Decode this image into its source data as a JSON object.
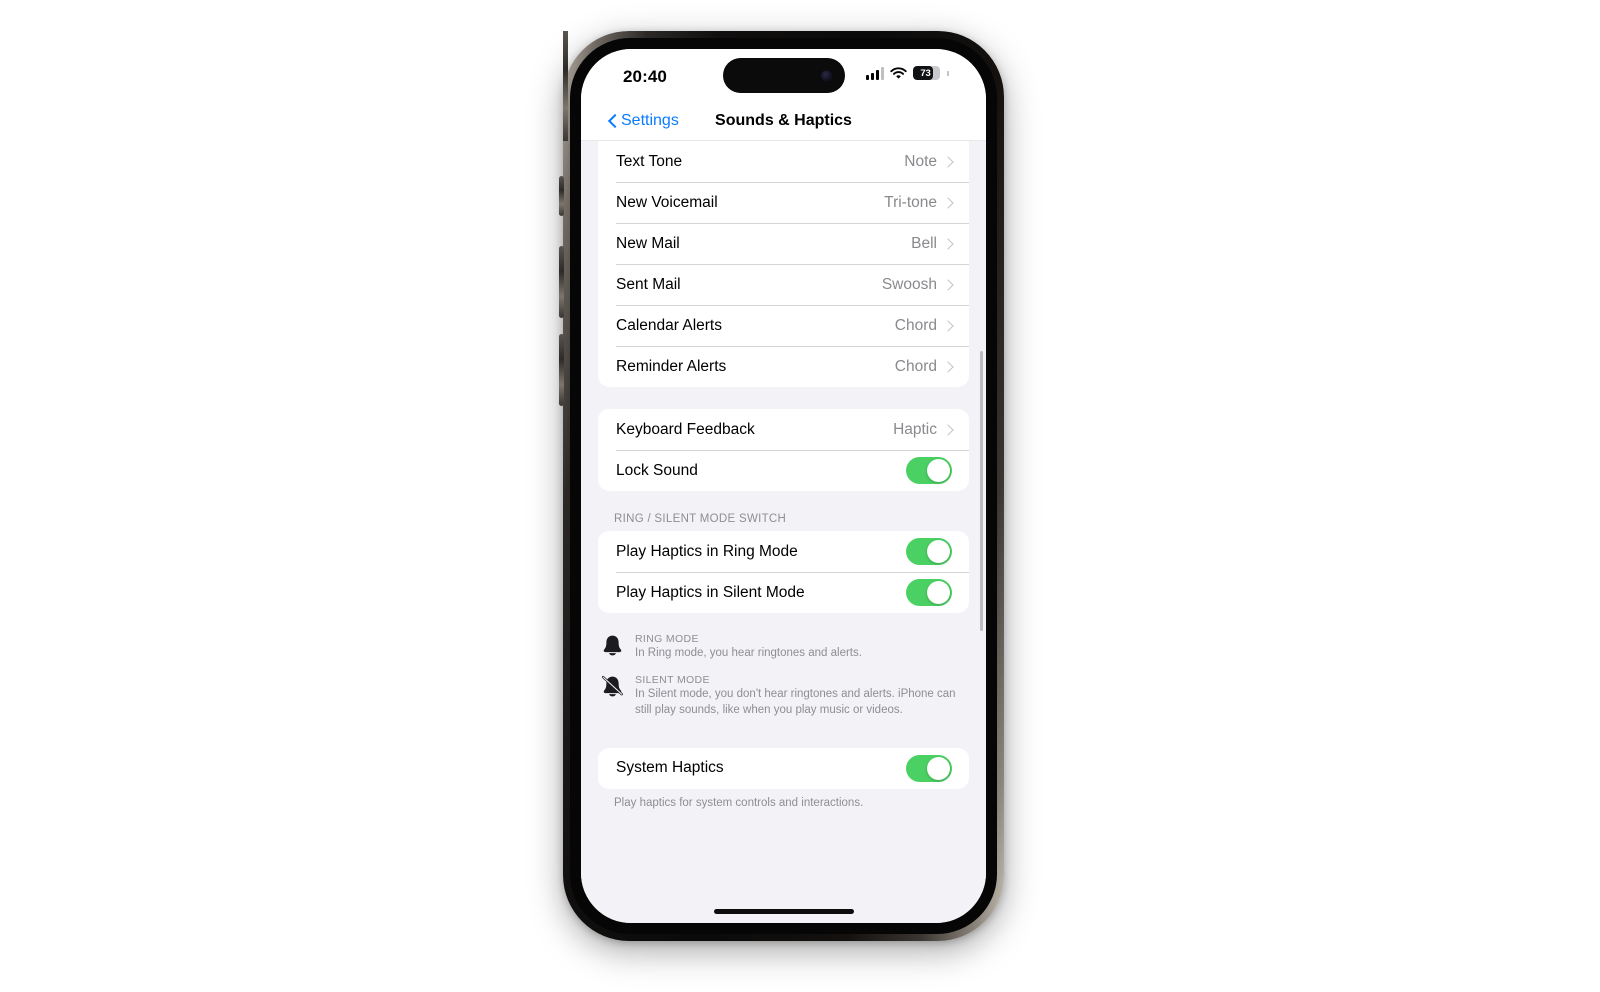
{
  "status_bar": {
    "time": "20:40",
    "signal_icon": "cellular-bars-icon",
    "wifi_icon": "wifi-icon",
    "battery_icon": "battery-icon",
    "battery_percent": "73",
    "battery_level": 73
  },
  "nav": {
    "back_label": "Settings",
    "back_icon": "chevron-left-icon",
    "title": "Sounds & Haptics"
  },
  "colors": {
    "accent_blue": "#0a7bff",
    "toggle_green": "#4bd163",
    "group_background": "#ffffff",
    "page_background": "#f2f2f7",
    "secondary_text": "#8e8e93"
  },
  "sound_group": {
    "rows": [
      {
        "label": "Text Tone",
        "value": "Note",
        "accessory": "chevron-right-icon"
      },
      {
        "label": "New Voicemail",
        "value": "Tri-tone",
        "accessory": "chevron-right-icon"
      },
      {
        "label": "New Mail",
        "value": "Bell",
        "accessory": "chevron-right-icon"
      },
      {
        "label": "Sent Mail",
        "value": "Swoosh",
        "accessory": "chevron-right-icon"
      },
      {
        "label": "Calendar Alerts",
        "value": "Chord",
        "accessory": "chevron-right-icon"
      },
      {
        "label": "Reminder Alerts",
        "value": "Chord",
        "accessory": "chevron-right-icon"
      }
    ]
  },
  "keyboard_group": {
    "rows": [
      {
        "label": "Keyboard Feedback",
        "value": "Haptic",
        "accessory": "chevron-right-icon"
      },
      {
        "label": "Lock Sound",
        "toggle": "on"
      }
    ]
  },
  "ring_silent_section": {
    "header": "Ring / Silent Mode Switch",
    "rows": [
      {
        "label": "Play Haptics in Ring Mode",
        "toggle": "on"
      },
      {
        "label": "Play Haptics in Silent Mode",
        "toggle": "on"
      }
    ],
    "info": [
      {
        "icon": "bell-icon",
        "title": "Ring Mode",
        "description": "In Ring mode, you hear ringtones and alerts."
      },
      {
        "icon": "bell-slash-icon",
        "title": "Silent Mode",
        "description": "In Silent mode, you don't hear ringtones and alerts. iPhone can still play sounds, like when you play music or videos."
      }
    ]
  },
  "system_haptics_section": {
    "rows": [
      {
        "label": "System Haptics",
        "toggle": "on"
      }
    ],
    "footer": "Play haptics for system controls and interactions."
  }
}
